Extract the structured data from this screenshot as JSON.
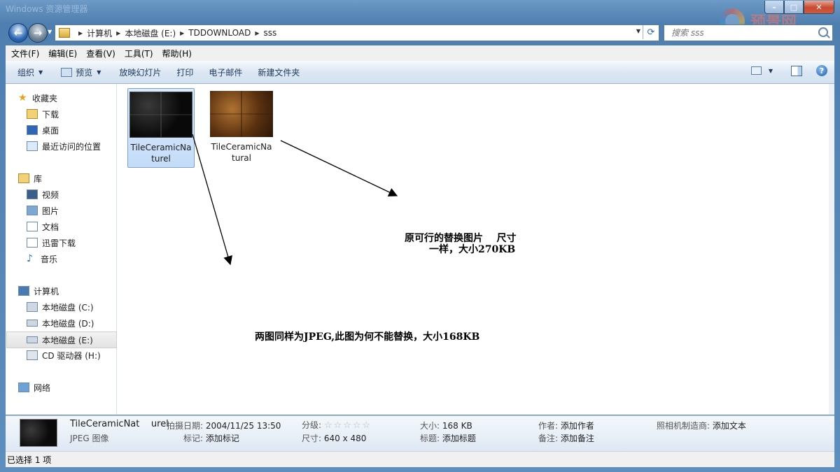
{
  "window": {
    "title": "Windows 资源管理器"
  },
  "address": {
    "crumbs": [
      "计算机",
      "本地磁盘 (E:)",
      "TDDOWNLOAD",
      "sss"
    ],
    "search_placeholder": "搜索 sss"
  },
  "watermark": {
    "text": "预景网"
  },
  "menu": [
    "文件(F)",
    "编辑(E)",
    "查看(V)",
    "工具(T)",
    "帮助(H)"
  ],
  "toolbar": {
    "organize": "组织",
    "preview": "预览",
    "slideshow": "放映幻灯片",
    "print": "打印",
    "email": "电子邮件",
    "new_folder": "新建文件夹"
  },
  "nav": {
    "favorites": "收藏夹",
    "downloads": "下载",
    "desktop": "桌面",
    "recent": "最近访问的位置",
    "libraries": "库",
    "videos": "视频",
    "pictures": "图片",
    "documents": "文档",
    "thunder": "迅雷下载",
    "music": "音乐",
    "computer": "计算机",
    "drive_c": "本地磁盘 (C:)",
    "drive_d": "本地磁盘 (D:)",
    "drive_e": "本地磁盘 (E:)",
    "drive_h": "CD 驱动器 (H:)",
    "network": "网络"
  },
  "files": [
    {
      "name": "TileCeramicNaturel",
      "selected": true
    },
    {
      "name": "TileCeramicNatural",
      "selected": false
    }
  ],
  "annotations": {
    "top_note_line1": "原可行的替换图片    尺寸",
    "top_note_line2": "一样，大小270KB",
    "bottom_note": "两图同样为JPEG,此图为何不能替换，大小168KB"
  },
  "details": {
    "name": "TileCeramicNat    urel",
    "type": "JPEG 图像",
    "date_label": "拍摄日期:",
    "date_value": "2004/11/25 13:50",
    "tags_label": "标记:",
    "tags_value": "添加标记",
    "rating_label": "分级:",
    "rating_stars": "☆☆☆☆☆",
    "dims_label": "尺寸:",
    "dims_value": "640 x 480",
    "size_label": "大小:",
    "size_value": "168 KB",
    "title_label": "标题:",
    "title_value": "添加标题",
    "author_label": "作者:",
    "author_value": "添加作者",
    "comment_label": "备注:",
    "comment_value": "添加备注",
    "maker_label": "照相机制造商:",
    "maker_value": "添加文本"
  },
  "status": {
    "text": "已选择 1 项"
  }
}
